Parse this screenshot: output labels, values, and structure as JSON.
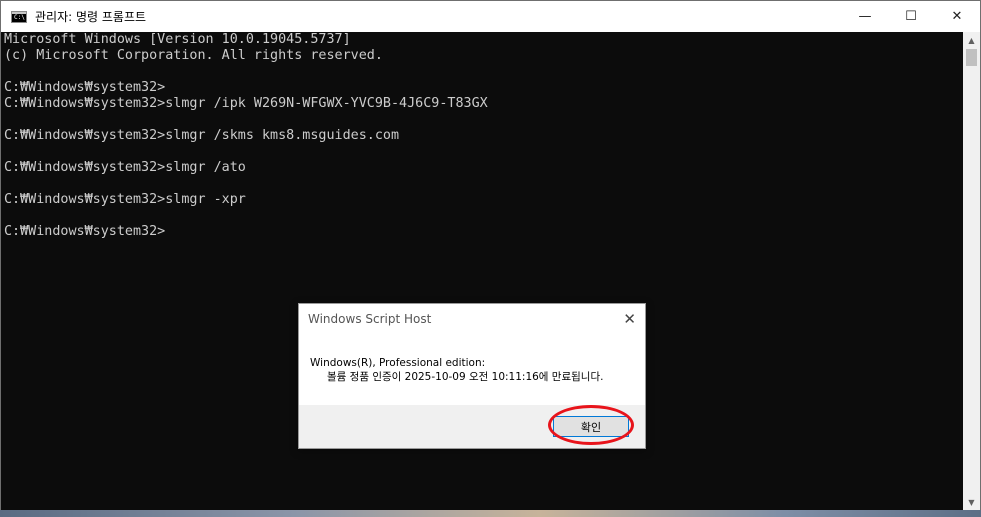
{
  "window": {
    "title": "관리자: 명령 프롬프트",
    "icon_label": "C:\\",
    "controls": {
      "minimize": "—",
      "maximize": "☐",
      "close": "✕"
    }
  },
  "console": {
    "lines": [
      "Microsoft Windows [Version 10.0.19045.5737]",
      "(c) Microsoft Corporation. All rights reserved.",
      "",
      "C:₩Windows₩system32>",
      "C:₩Windows₩system32>slmgr /ipk W269N-WFGWX-YVC9B-4J6C9-T83GX",
      "",
      "C:₩Windows₩system32>slmgr /skms kms8.msguides.com",
      "",
      "C:₩Windows₩system32>slmgr /ato",
      "",
      "C:₩Windows₩system32>slmgr -xpr",
      "",
      "C:₩Windows₩system32>"
    ]
  },
  "scrollbar": {
    "up": "▲",
    "down": "▼"
  },
  "dialog": {
    "title": "Windows Script Host",
    "close": "✕",
    "message_line1": "Windows(R), Professional edition:",
    "message_line2": "볼륨 정품 인증이 2025-10-09 오전 10:11:16에 만료됩니다.",
    "ok_label": "확인"
  },
  "colors": {
    "console_bg": "#0c0c0c",
    "console_text": "#cccccc",
    "highlight": "#e8141b",
    "button_focus": "#0078d7"
  }
}
